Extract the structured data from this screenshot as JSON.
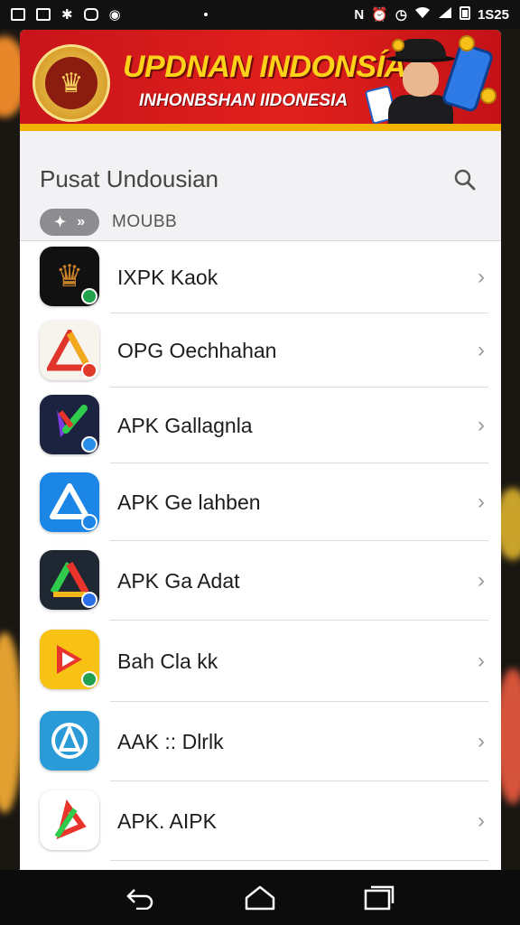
{
  "status_bar": {
    "time": "1S25",
    "icons": [
      "gallery-icon",
      "image-icon",
      "settings-icon",
      "game-icon",
      "chat-icon",
      "nfc-icon",
      "alarm-icon",
      "clock-icon",
      "wifi-icon",
      "signal-icon",
      "battery-icon"
    ]
  },
  "banner": {
    "title": "UPDNAN INDONSÍA",
    "subtitle": "INHONBSHAN IIDONESIA",
    "colors": {
      "background": "#d91a1c",
      "title": "#ffd21a",
      "subtitle": "#ffffff"
    }
  },
  "header": {
    "title": "Pusat Undousian",
    "mode_label": "MOUBB",
    "toggle_icons": [
      "pin-icon",
      "chevron-right-icon"
    ]
  },
  "apps": [
    {
      "label": "IXPK Kaok",
      "icon": "garuda-icon",
      "icon_bg": "#111111",
      "badge": "#22a24a"
    },
    {
      "label": "OPG Oechhahan",
      "icon": "apk-triangle-icon",
      "icon_bg": "#f7f4ee",
      "badge": "#e03a2a"
    },
    {
      "label": "APK Gallagnla",
      "icon": "brush-icon",
      "icon_bg": "#1c2340",
      "badge": "#2a8ee8"
    },
    {
      "label": "APK Ge lahben",
      "icon": "store-a-icon",
      "icon_bg": "#1b86e6",
      "badge": "#1b86e6"
    },
    {
      "label": "APK Ga Adat",
      "icon": "drive-triangle-icon",
      "icon_bg": "#1f2733",
      "badge": "#2a6fe8"
    },
    {
      "label": "Bah Cla kk",
      "icon": "play-icon",
      "icon_bg": "#f7c213",
      "badge": "#20a050"
    },
    {
      "label": "AAK :: Dlrlk",
      "icon": "a-circle-icon",
      "icon_bg": "#2a9bd6",
      "badge": ""
    },
    {
      "label": "APK. AIPK",
      "icon": "pen-icon",
      "icon_bg": "#ffffff",
      "badge": ""
    }
  ],
  "nav": [
    "back-icon",
    "home-icon",
    "recents-icon"
  ]
}
